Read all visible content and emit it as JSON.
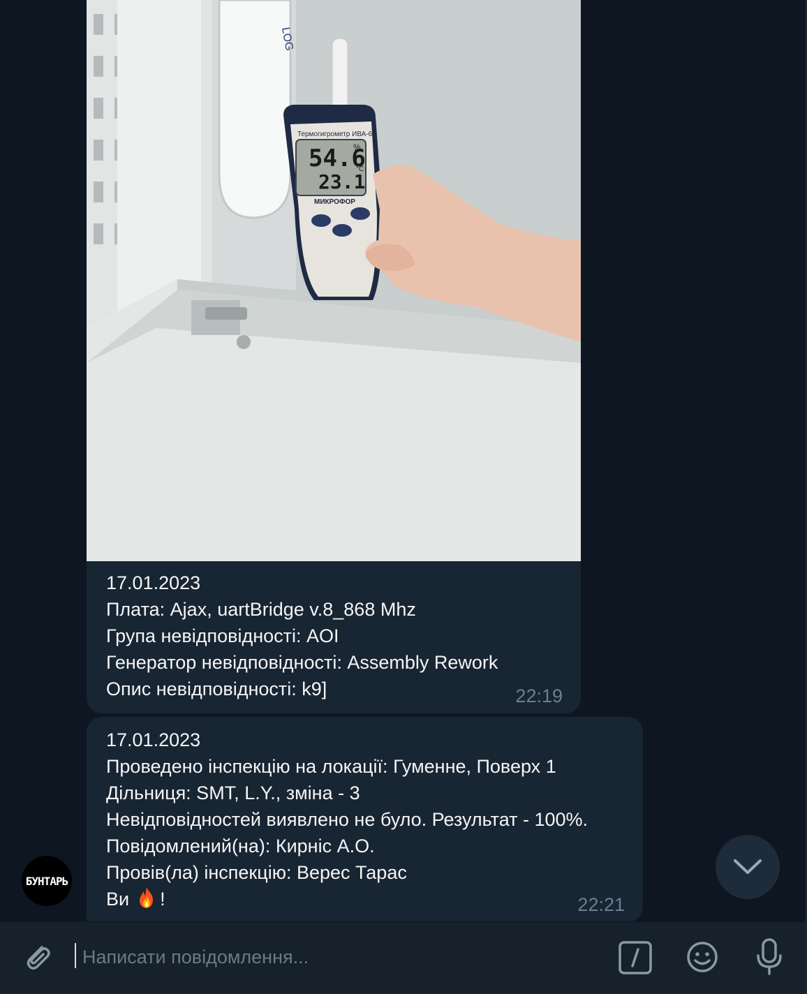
{
  "message1": {
    "lines": [
      "17.01.2023",
      "Плата: Ajax, uartBridge v.8_868 Mhz",
      "Група невідповідності: AOI",
      "Генератор невідповідності: Assembly Rework",
      "Опис невідповідності: k9]"
    ],
    "time": "22:19"
  },
  "photo": {
    "device_title": "Термогигрометр ИВА-6",
    "humidity": "54.6",
    "humidity_unit": "%",
    "temperature": "23.1",
    "temperature_unit": "°C",
    "brand": "МИКРОФОР"
  },
  "message2": {
    "lines": [
      "17.01.2023",
      "Проведено інспекцію на локації: Гуменне, Поверх 1",
      "Дільниця: SMT, L.Y., зміна - 3",
      "Невідповідностей виявлено не було. Результат - 100%.",
      "Повідомлений(на): Кирніс А.О.",
      "Провів(ла) інспекцію: Верес Тарас"
    ],
    "closing_prefix": "Ви",
    "closing_suffix": "!",
    "closing_emoji": "fire",
    "time": "22:21"
  },
  "avatar": {
    "text": "БУНТАРЬ"
  },
  "composer": {
    "placeholder": "Написати повідомлення..."
  },
  "colors": {
    "background": "#0e1621",
    "bubble": "#182533",
    "composer": "#17212b",
    "timestamp": "#6d7f8f",
    "icon": "#8a98a6"
  }
}
